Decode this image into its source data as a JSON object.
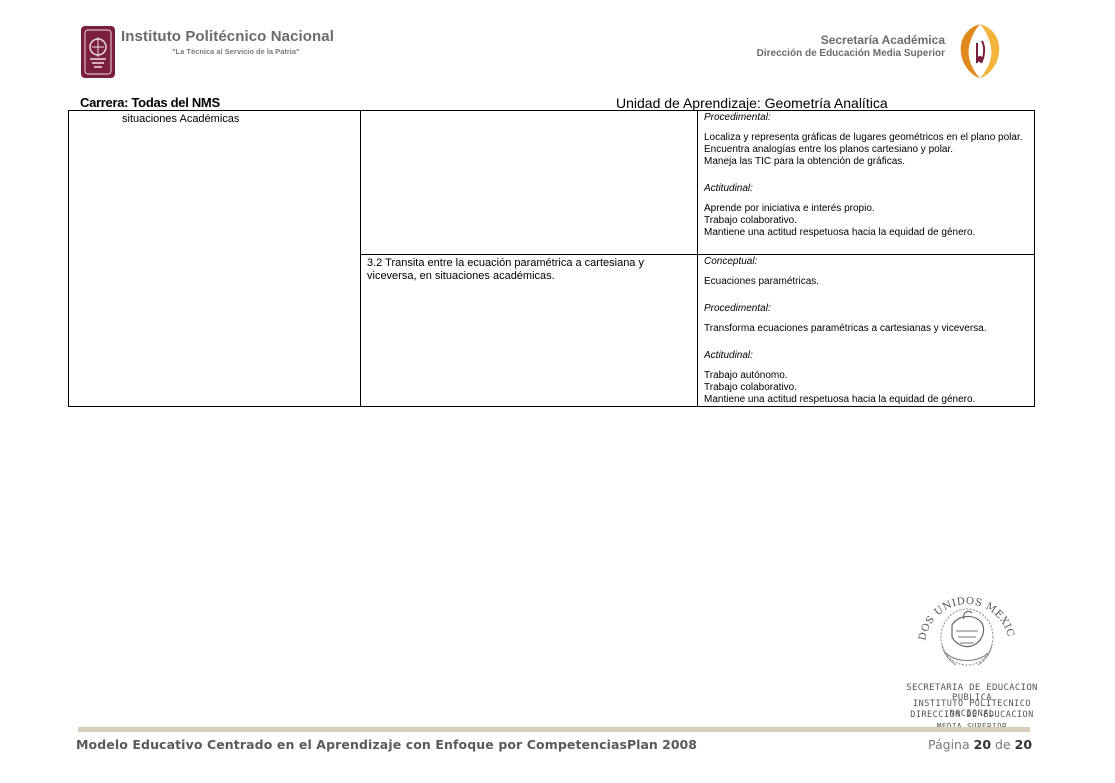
{
  "header": {
    "institution": "Instituto Politécnico Nacional",
    "motto": "\"La Técnica al Servicio de la Patria\"",
    "secretariat": "Secretaría Académica",
    "direction": "Dirección de Educación Media Superior",
    "career": "Carrera: Todas del NMS",
    "unit": "Unidad de Aprendizaje: Geometría Analítica"
  },
  "table": {
    "row1": {
      "col1": "situaciones Académicas",
      "col2": "",
      "sections": [
        {
          "heading": "Procedimental:",
          "lines": [
            "Localiza y representa gráficas de lugares geométricos en el plano polar.",
            "Encuentra analogías entre los planos cartesiano y polar.",
            "Maneja las TIC para la obtención de gráficas."
          ]
        },
        {
          "heading": "Actitudinal:",
          "lines": [
            "Aprende por iniciativa e interés propio.",
            "Trabajo colaborativo.",
            "Mantiene una actitud respetuosa hacia la equidad de género."
          ]
        }
      ]
    },
    "row2": {
      "col2": "3.2  Transita entre la ecuación paramétrica a cartesiana y viceversa, en situaciones académicas.",
      "sections": [
        {
          "heading": "Conceptual:",
          "lines": [
            "Ecuaciones paramétricas."
          ]
        },
        {
          "heading": "Procedimental:",
          "lines": [
            "Transforma ecuaciones paramétricas a cartesianas y viceversa."
          ]
        },
        {
          "heading": "Actitudinal:",
          "lines": [
            "Trabajo autónomo.",
            "Trabajo colaborativo.",
            "Mantiene una actitud respetuosa hacia la equidad de género."
          ]
        }
      ]
    }
  },
  "seal": {
    "arc_text": "ESTADOS UNIDOS MEXICANOS",
    "stamp_lines": [
      "SECRETARIA DE EDUCACION PUBLICA",
      "INSTITUTO  POLITECNICO  NACIONAL",
      "DIRECCION  DE  EDUCACION",
      "MEDIA  SUPERIOR"
    ]
  },
  "footer": {
    "model": "Modelo Educativo Centrado en el Aprendizaje con Enfoque por Competencias",
    "plan": "Plan 2008",
    "page_label": "Página",
    "page_current": "20",
    "page_of": "de",
    "page_total": "20"
  },
  "colors": {
    "ipn_guinda": "#7a1f3d",
    "dems_orange": "#e08a1e",
    "footer_bar": "#d6cdbb"
  }
}
